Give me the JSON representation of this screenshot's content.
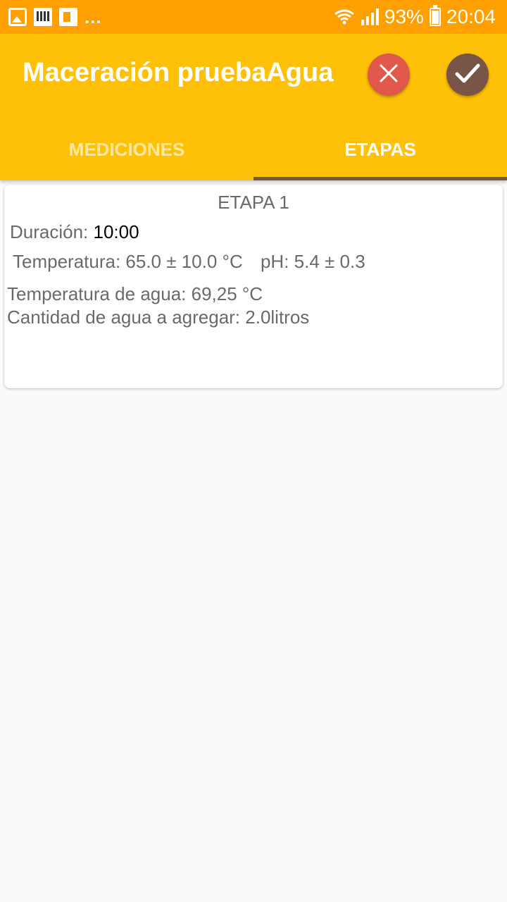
{
  "status_bar": {
    "more_indicator": "...",
    "battery_percent": "93%",
    "time": "20:04",
    "icons": [
      "gallery-icon",
      "app-notification-icon",
      "flipboard-icon",
      "wifi-icon",
      "signal-icon",
      "battery-icon"
    ]
  },
  "app_bar": {
    "title": "Maceración pruebaAgua",
    "cancel_icon": "close-icon",
    "confirm_icon": "check-icon",
    "colors": {
      "primary": "#FFC107",
      "status": "#FFA000",
      "accent": "#795548",
      "cancel": "#E0584A"
    }
  },
  "tabs": [
    {
      "label": "MEDICIONES",
      "selected": false
    },
    {
      "label": "ETAPAS",
      "selected": true
    }
  ],
  "stage": {
    "title": "ETAPA 1",
    "duration_label": "Duración:",
    "duration_value": "10:00",
    "temperature": "Temperatura: 65.0 ± 10.0 °C",
    "ph": "pH: 5.4 ± 0.3",
    "water_temperature": "Temperatura de agua: 69,25 °C",
    "water_amount": "Cantidad de agua a agregar: 2.0litros"
  }
}
